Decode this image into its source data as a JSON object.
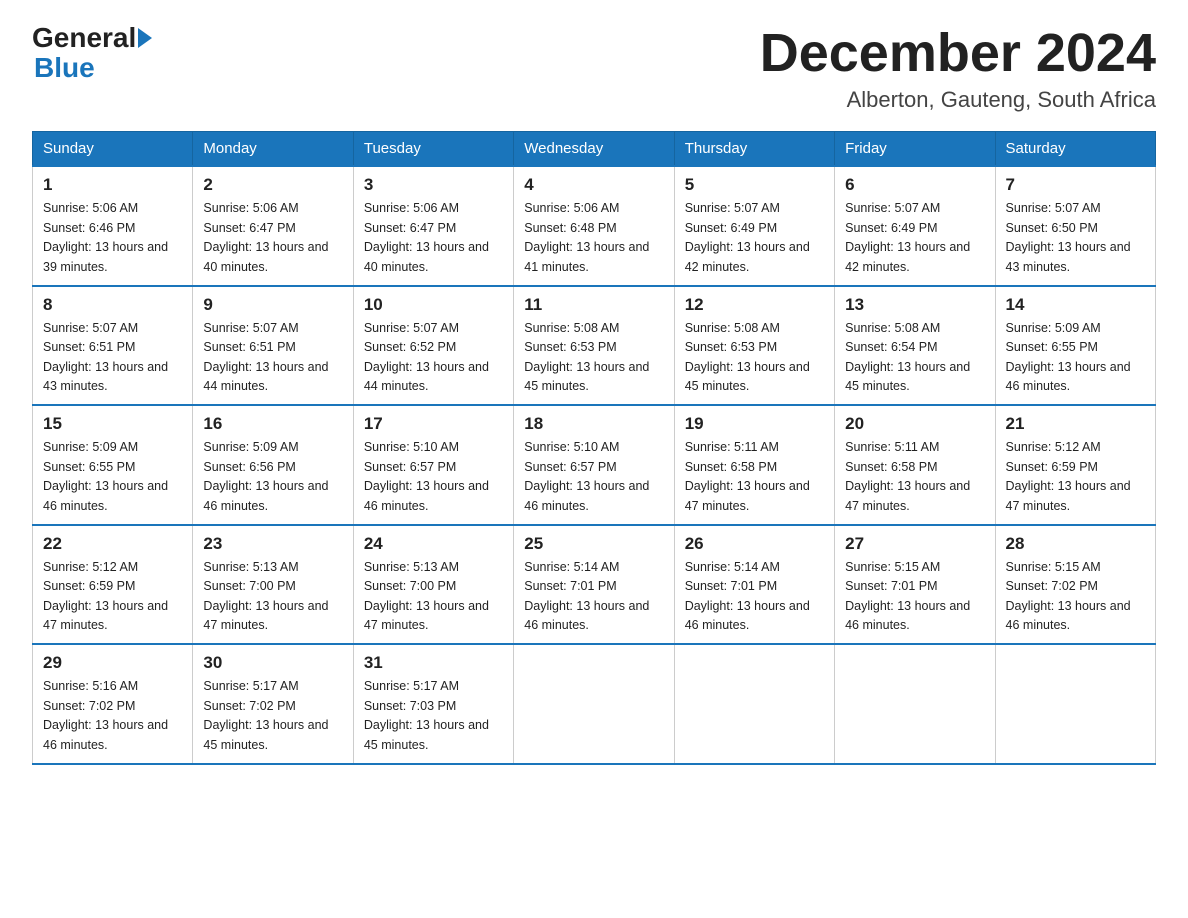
{
  "header": {
    "logo_general": "General",
    "logo_blue": "Blue",
    "month_title": "December 2024",
    "subtitle": "Alberton, Gauteng, South Africa"
  },
  "days_of_week": [
    "Sunday",
    "Monday",
    "Tuesday",
    "Wednesday",
    "Thursday",
    "Friday",
    "Saturday"
  ],
  "weeks": [
    [
      {
        "day": "1",
        "sunrise": "5:06 AM",
        "sunset": "6:46 PM",
        "daylight": "13 hours and 39 minutes."
      },
      {
        "day": "2",
        "sunrise": "5:06 AM",
        "sunset": "6:47 PM",
        "daylight": "13 hours and 40 minutes."
      },
      {
        "day": "3",
        "sunrise": "5:06 AM",
        "sunset": "6:47 PM",
        "daylight": "13 hours and 40 minutes."
      },
      {
        "day": "4",
        "sunrise": "5:06 AM",
        "sunset": "6:48 PM",
        "daylight": "13 hours and 41 minutes."
      },
      {
        "day": "5",
        "sunrise": "5:07 AM",
        "sunset": "6:49 PM",
        "daylight": "13 hours and 42 minutes."
      },
      {
        "day": "6",
        "sunrise": "5:07 AM",
        "sunset": "6:49 PM",
        "daylight": "13 hours and 42 minutes."
      },
      {
        "day": "7",
        "sunrise": "5:07 AM",
        "sunset": "6:50 PM",
        "daylight": "13 hours and 43 minutes."
      }
    ],
    [
      {
        "day": "8",
        "sunrise": "5:07 AM",
        "sunset": "6:51 PM",
        "daylight": "13 hours and 43 minutes."
      },
      {
        "day": "9",
        "sunrise": "5:07 AM",
        "sunset": "6:51 PM",
        "daylight": "13 hours and 44 minutes."
      },
      {
        "day": "10",
        "sunrise": "5:07 AM",
        "sunset": "6:52 PM",
        "daylight": "13 hours and 44 minutes."
      },
      {
        "day": "11",
        "sunrise": "5:08 AM",
        "sunset": "6:53 PM",
        "daylight": "13 hours and 45 minutes."
      },
      {
        "day": "12",
        "sunrise": "5:08 AM",
        "sunset": "6:53 PM",
        "daylight": "13 hours and 45 minutes."
      },
      {
        "day": "13",
        "sunrise": "5:08 AM",
        "sunset": "6:54 PM",
        "daylight": "13 hours and 45 minutes."
      },
      {
        "day": "14",
        "sunrise": "5:09 AM",
        "sunset": "6:55 PM",
        "daylight": "13 hours and 46 minutes."
      }
    ],
    [
      {
        "day": "15",
        "sunrise": "5:09 AM",
        "sunset": "6:55 PM",
        "daylight": "13 hours and 46 minutes."
      },
      {
        "day": "16",
        "sunrise": "5:09 AM",
        "sunset": "6:56 PM",
        "daylight": "13 hours and 46 minutes."
      },
      {
        "day": "17",
        "sunrise": "5:10 AM",
        "sunset": "6:57 PM",
        "daylight": "13 hours and 46 minutes."
      },
      {
        "day": "18",
        "sunrise": "5:10 AM",
        "sunset": "6:57 PM",
        "daylight": "13 hours and 46 minutes."
      },
      {
        "day": "19",
        "sunrise": "5:11 AM",
        "sunset": "6:58 PM",
        "daylight": "13 hours and 47 minutes."
      },
      {
        "day": "20",
        "sunrise": "5:11 AM",
        "sunset": "6:58 PM",
        "daylight": "13 hours and 47 minutes."
      },
      {
        "day": "21",
        "sunrise": "5:12 AM",
        "sunset": "6:59 PM",
        "daylight": "13 hours and 47 minutes."
      }
    ],
    [
      {
        "day": "22",
        "sunrise": "5:12 AM",
        "sunset": "6:59 PM",
        "daylight": "13 hours and 47 minutes."
      },
      {
        "day": "23",
        "sunrise": "5:13 AM",
        "sunset": "7:00 PM",
        "daylight": "13 hours and 47 minutes."
      },
      {
        "day": "24",
        "sunrise": "5:13 AM",
        "sunset": "7:00 PM",
        "daylight": "13 hours and 47 minutes."
      },
      {
        "day": "25",
        "sunrise": "5:14 AM",
        "sunset": "7:01 PM",
        "daylight": "13 hours and 46 minutes."
      },
      {
        "day": "26",
        "sunrise": "5:14 AM",
        "sunset": "7:01 PM",
        "daylight": "13 hours and 46 minutes."
      },
      {
        "day": "27",
        "sunrise": "5:15 AM",
        "sunset": "7:01 PM",
        "daylight": "13 hours and 46 minutes."
      },
      {
        "day": "28",
        "sunrise": "5:15 AM",
        "sunset": "7:02 PM",
        "daylight": "13 hours and 46 minutes."
      }
    ],
    [
      {
        "day": "29",
        "sunrise": "5:16 AM",
        "sunset": "7:02 PM",
        "daylight": "13 hours and 46 minutes."
      },
      {
        "day": "30",
        "sunrise": "5:17 AM",
        "sunset": "7:02 PM",
        "daylight": "13 hours and 45 minutes."
      },
      {
        "day": "31",
        "sunrise": "5:17 AM",
        "sunset": "7:03 PM",
        "daylight": "13 hours and 45 minutes."
      },
      null,
      null,
      null,
      null
    ]
  ],
  "labels": {
    "sunrise": "Sunrise: ",
    "sunset": "Sunset: ",
    "daylight": "Daylight: "
  }
}
